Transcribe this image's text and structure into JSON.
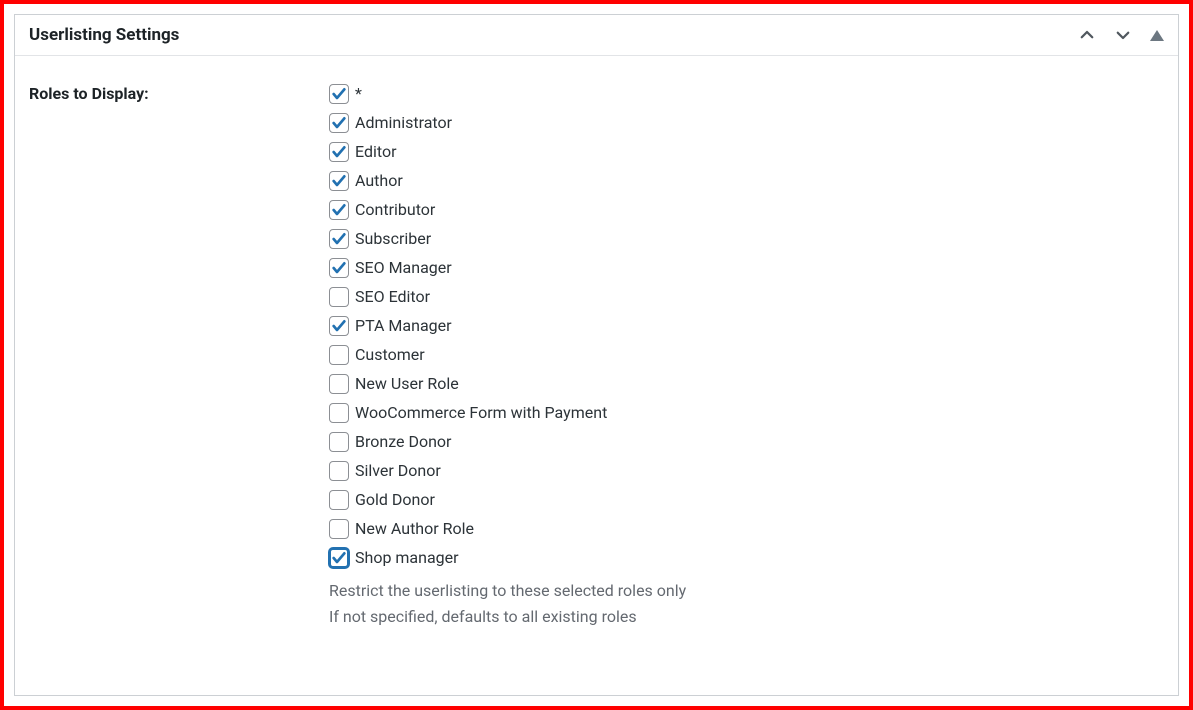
{
  "panel": {
    "title": "Userlisting Settings"
  },
  "field": {
    "label": "Roles to Display:",
    "help_line_1": "Restrict the userlisting to these selected roles only",
    "help_line_2": "If not specified, defaults to all existing roles"
  },
  "roles": [
    {
      "label": "*",
      "checked": true,
      "focused": false
    },
    {
      "label": "Administrator",
      "checked": true,
      "focused": false
    },
    {
      "label": "Editor",
      "checked": true,
      "focused": false
    },
    {
      "label": "Author",
      "checked": true,
      "focused": false
    },
    {
      "label": "Contributor",
      "checked": true,
      "focused": false
    },
    {
      "label": "Subscriber",
      "checked": true,
      "focused": false
    },
    {
      "label": "SEO Manager",
      "checked": true,
      "focused": false
    },
    {
      "label": "SEO Editor",
      "checked": false,
      "focused": false
    },
    {
      "label": "PTA Manager",
      "checked": true,
      "focused": false
    },
    {
      "label": "Customer",
      "checked": false,
      "focused": false
    },
    {
      "label": "New User Role",
      "checked": false,
      "focused": false
    },
    {
      "label": "WooCommerce Form with Payment",
      "checked": false,
      "focused": false
    },
    {
      "label": "Bronze Donor",
      "checked": false,
      "focused": false
    },
    {
      "label": "Silver Donor",
      "checked": false,
      "focused": false
    },
    {
      "label": "Gold Donor",
      "checked": false,
      "focused": false
    },
    {
      "label": "New Author Role",
      "checked": false,
      "focused": false
    },
    {
      "label": "Shop manager",
      "checked": true,
      "focused": true
    }
  ]
}
